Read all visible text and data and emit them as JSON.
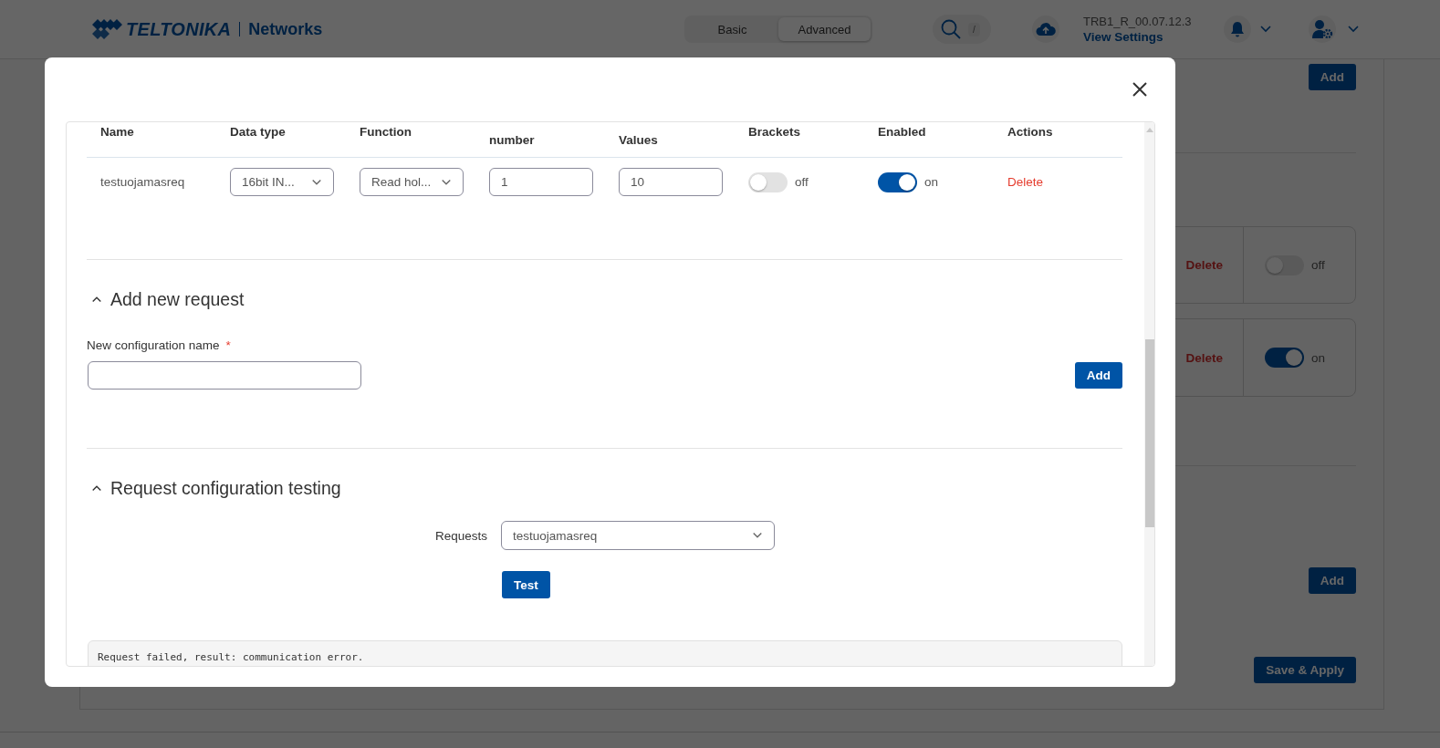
{
  "header": {
    "logo": {
      "brand": "TELTONIKA",
      "product": "Networks"
    },
    "mode_tabs": [
      {
        "label": "Basic",
        "selected": false
      },
      {
        "label": "Advanced",
        "selected": true
      }
    ],
    "search_shortcut": "/",
    "firmware_version": "TRB1_R_00.07.12.3",
    "view_settings_link": "View Settings"
  },
  "background": {
    "top_button": "Add",
    "cards": [
      {
        "action": "Delete",
        "on": false,
        "toggle_label": "off"
      },
      {
        "action": "Delete",
        "on": true,
        "toggle_label": "on"
      }
    ],
    "bottom_button": "Add",
    "save_button": "Save & Apply"
  },
  "modal": {
    "table": {
      "columns": [
        {
          "label": "Name",
          "kind": "single"
        },
        {
          "label": "Data type",
          "kind": "single"
        },
        {
          "label": "Function",
          "kind": "single"
        },
        {
          "label": "number",
          "kind": "second_line"
        },
        {
          "label": "Values",
          "kind": "second_line"
        },
        {
          "label": "Brackets",
          "kind": "single"
        },
        {
          "label": "Enabled",
          "kind": "single"
        },
        {
          "label": "Actions",
          "kind": "single"
        }
      ],
      "rows": [
        {
          "name": "testuojamasreq",
          "data_type": "16bit IN...",
          "function": "Read hol...",
          "column_4": "1",
          "column_5": "10",
          "brackets": {
            "on": false,
            "label": "off"
          },
          "enabled": {
            "on": true,
            "label": "on"
          },
          "action": "Delete"
        }
      ]
    },
    "add_section": {
      "title": "Add new request",
      "expanded": true,
      "field_label": "New configuration name",
      "required_mark": "*",
      "button": "Add"
    },
    "test_section": {
      "title": "Request configuration testing",
      "expanded": true,
      "requests_label": "Requests",
      "requests_value": "testuojamasreq",
      "button": "Test",
      "result": "Request failed, result: communication error."
    }
  }
}
